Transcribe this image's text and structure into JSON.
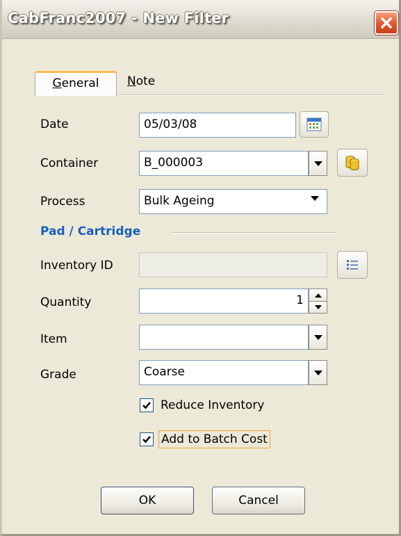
{
  "window": {
    "title": "CabFranc2007 - New Filter"
  },
  "tabs": [
    {
      "label": "General",
      "underline": "G",
      "rest": "eneral"
    },
    {
      "label": "Note",
      "underline": "N",
      "rest": "ote"
    }
  ],
  "form": {
    "date": {
      "label": "Date",
      "value": "05/03/08"
    },
    "container": {
      "label": "Container",
      "value": "B_000003"
    },
    "process": {
      "label": "Process",
      "value": "Bulk Ageing"
    },
    "section_title": "Pad / Cartridge",
    "inventory_id": {
      "label": "Inventory ID",
      "value": ""
    },
    "quantity": {
      "label": "Quantity",
      "value": "1"
    },
    "item": {
      "label": "Item",
      "value": ""
    },
    "grade": {
      "label": "Grade",
      "value": "Coarse"
    },
    "reduce_inventory": {
      "label": "Reduce Inventory",
      "checked": true
    },
    "add_to_batch_cost": {
      "label": "Add to Batch Cost",
      "checked": true
    }
  },
  "buttons": {
    "ok": "OK",
    "cancel": "Cancel"
  },
  "icons": {
    "close": "close-icon",
    "calendar": "calendar-icon",
    "containers": "containers-icon",
    "list": "list-icon"
  },
  "colors": {
    "section_title": "#1a5fbd",
    "close": "#e2532c",
    "tab_accent": "#f7bd4f"
  }
}
